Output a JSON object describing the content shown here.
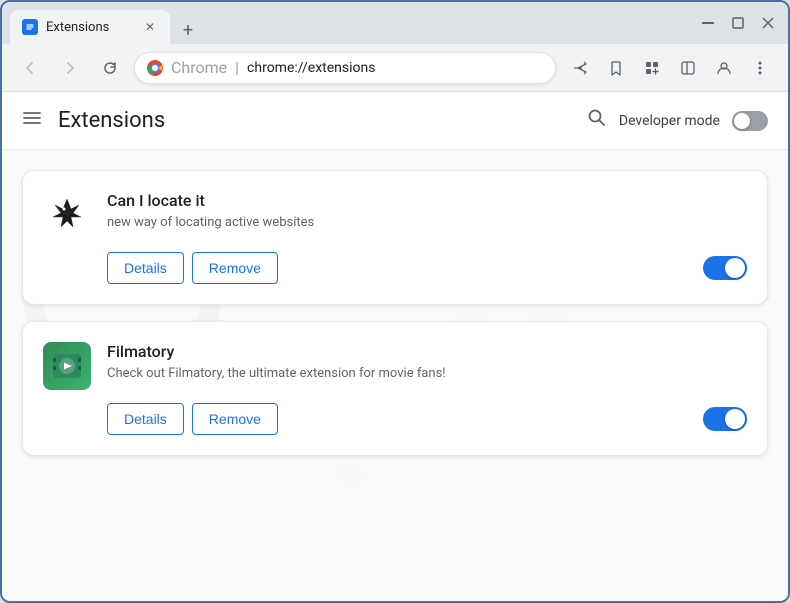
{
  "browser": {
    "tab_title": "Extensions",
    "tab_favicon": "🔧",
    "new_tab_symbol": "+",
    "window_controls": {
      "minimize": "—",
      "maximize": "⬜",
      "close": "✕"
    },
    "nav": {
      "back_disabled": true,
      "forward_disabled": true,
      "reload": "↻",
      "address_bar": {
        "favicon_alt": "Chrome",
        "site_name": "Chrome",
        "separator": "|",
        "url": "chrome://extensions"
      }
    },
    "toolbar_icons": {
      "share": "↗",
      "bookmark": "☆",
      "extensions": "🧩",
      "profile": "👤",
      "menu": "⋮"
    }
  },
  "page": {
    "title": "Extensions",
    "search_icon": "🔍",
    "developer_mode_label": "Developer mode",
    "developer_mode_enabled": false,
    "extensions": [
      {
        "id": "can-locate-it",
        "name": "Can I locate it",
        "description": "new way of locating active websites",
        "enabled": true,
        "details_label": "Details",
        "remove_label": "Remove",
        "icon_type": "bird"
      },
      {
        "id": "filmatory",
        "name": "Filmatory",
        "description": "Check out Filmatory, the ultimate extension for movie fans!",
        "enabled": true,
        "details_label": "Details",
        "remove_label": "Remove",
        "icon_type": "film"
      }
    ]
  }
}
